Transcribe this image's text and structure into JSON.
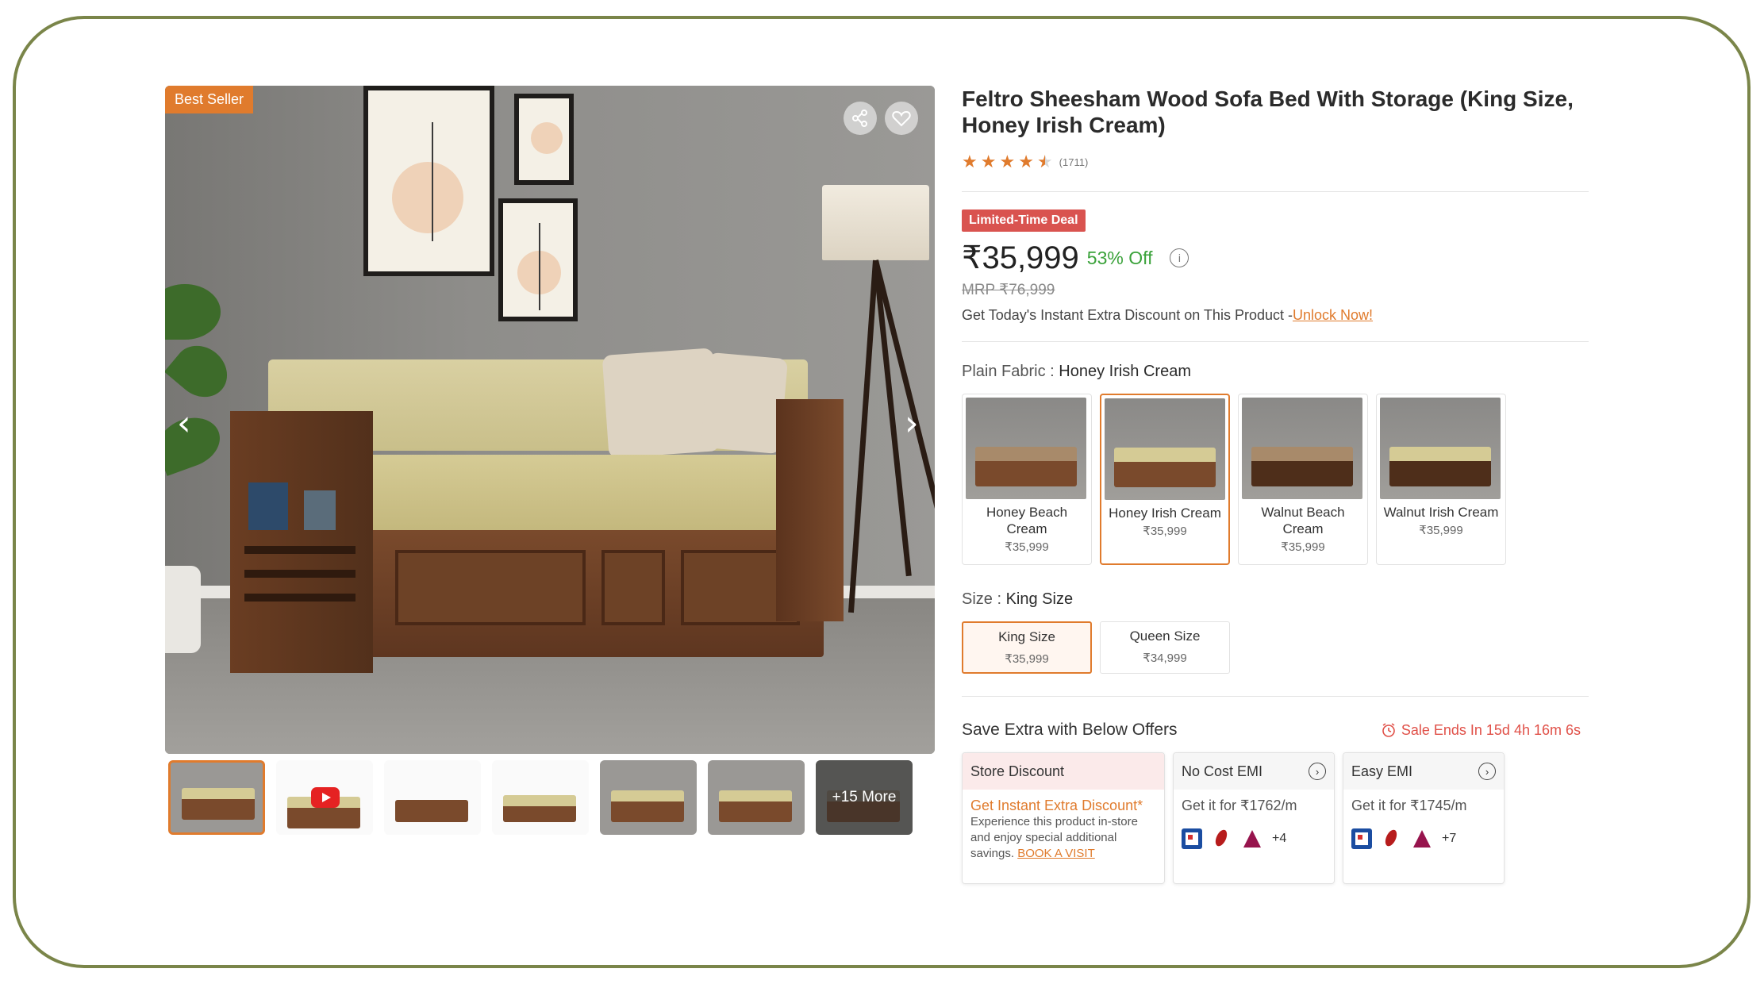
{
  "gallery": {
    "badge": "Best Seller",
    "more_label": "+15 More"
  },
  "product": {
    "title": "Feltro Sheesham Wood Sofa Bed With Storage (King Size, Honey Irish Cream)",
    "rating_count": "(1711)",
    "deal_badge": "Limited-Time Deal",
    "price": "₹35,999",
    "discount": "53% Off",
    "mrp": "MRP ₹76,999",
    "extra_text": "Get Today's Instant Extra Discount on This Product -",
    "unlock_link": "Unlock Now!"
  },
  "fabric": {
    "label": "Plain Fabric : ",
    "selected": "Honey Irish Cream",
    "options": [
      {
        "name": "Honey Beach Cream",
        "price": "₹35,999",
        "sofa_color": "#7a4a2c",
        "seat_color": "#a88a6a"
      },
      {
        "name": "Honey Irish Cream",
        "price": "₹35,999",
        "sofa_color": "#7a4a2c",
        "seat_color": "#d5cb95"
      },
      {
        "name": "Walnut Beach Cream",
        "price": "₹35,999",
        "sofa_color": "#4e2e1a",
        "seat_color": "#a88a6a"
      },
      {
        "name": "Walnut Irish Cream",
        "price": "₹35,999",
        "sofa_color": "#4e2e1a",
        "seat_color": "#d5cb95"
      }
    ]
  },
  "size": {
    "label": "Size : ",
    "selected": "King Size",
    "options": [
      {
        "name": "King Size",
        "price": "₹35,999"
      },
      {
        "name": "Queen Size",
        "price": "₹34,999"
      }
    ]
  },
  "offers": {
    "title": "Save Extra with Below Offers",
    "sale_timer": "Sale Ends In 15d 4h 16m 6s",
    "store": {
      "title": "Store Discount",
      "highlight": "Get Instant Extra Discount*",
      "text": "Experience this product in-store and enjoy special additional savings.",
      "link": "BOOK A VISIT"
    },
    "no_cost_emi": {
      "title": "No Cost EMI",
      "text": "Get it for ₹1762/m",
      "more_banks": "+4"
    },
    "easy_emi": {
      "title": "Easy EMI",
      "text": "Get it for ₹1745/m",
      "more_banks": "+7"
    }
  },
  "colors": {
    "accent": "#e07b2d",
    "deal": "#d9534f",
    "discount": "#3aa23a",
    "frame": "#7a8549"
  }
}
